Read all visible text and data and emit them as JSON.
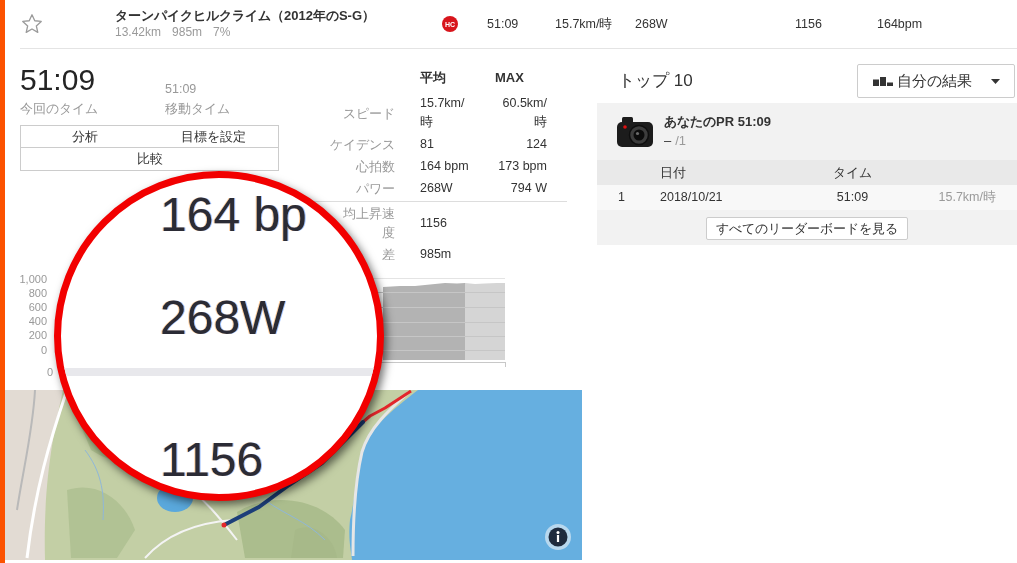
{
  "segment_row": {
    "starred": false,
    "name": "ターンパイクヒルクライム（2012年のS-G）",
    "distance": "13.42km",
    "elevation_gain": "985m",
    "grade": "7%",
    "climb_category": "HC",
    "time": "51:09",
    "speed": "15.7km/時",
    "power": "268W",
    "vam": "1156",
    "heart_rate": "164bpm"
  },
  "effort": {
    "elapsed_time": "51:09",
    "elapsed_label": "今回のタイム",
    "moving_time": "51:09",
    "moving_label": "移動タイム"
  },
  "actions": [
    [
      "分析",
      "目標を設定"
    ],
    [
      "比較"
    ]
  ],
  "stats": {
    "columns": [
      "平均",
      "MAX"
    ],
    "rows": [
      {
        "label": "スピード",
        "avg": "15.7km/時",
        "max": "60.5km/時"
      },
      {
        "label": "ケイデンス",
        "avg": "81",
        "max": "124"
      },
      {
        "label": "心拍数",
        "avg": "164 bpm",
        "max": "173 bpm"
      },
      {
        "label": "パワー",
        "avg": "268W",
        "max": "794 W"
      }
    ],
    "extra_rows": [
      {
        "label": "均上昇速度",
        "value": "1156"
      },
      {
        "label": "差",
        "value": "985m"
      }
    ]
  },
  "elevation_chart": {
    "y_labels": [
      "1,000",
      "800",
      "600",
      "400",
      "200",
      "0"
    ],
    "x_labels": [
      "0"
    ]
  },
  "magnifier": {
    "lines": [
      "164 bp",
      "268W",
      "1156"
    ]
  },
  "leaderboard": {
    "title": "トップ 10",
    "filter": "自分の結果",
    "pr": {
      "label": "あなたのPR 51:09",
      "rank": "–",
      "total": "/1"
    },
    "columns": [
      "日付",
      "タイム"
    ],
    "rows": [
      {
        "rank": "1",
        "date": "2018/10/21",
        "time": "51:09",
        "speed": "15.7km/時"
      }
    ],
    "view_all": "すべてのリーダーボードを見る"
  }
}
